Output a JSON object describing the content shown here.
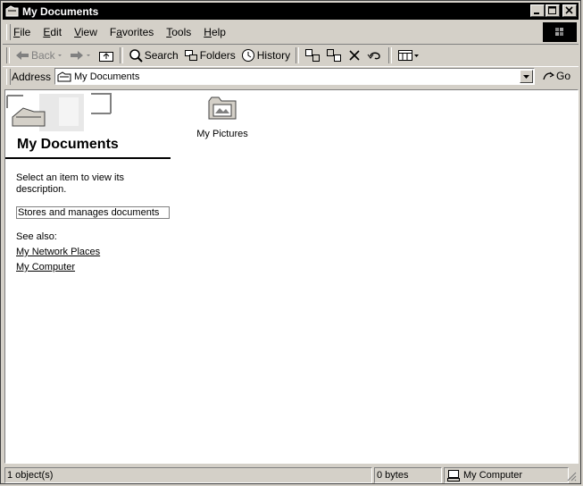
{
  "window": {
    "title": "My Documents"
  },
  "menu": [
    {
      "key": "F",
      "rest": "ile"
    },
    {
      "key": "E",
      "rest": "dit"
    },
    {
      "key": "V",
      "rest": "iew"
    },
    {
      "key": "F",
      "rest": "avorites",
      "prefix": "",
      "full": "Favorites"
    },
    {
      "key": "T",
      "rest": "ools"
    },
    {
      "key": "H",
      "rest": "elp"
    }
  ],
  "toolbar": {
    "back_label": "Back",
    "search_label": "Search",
    "folders_label": "Folders",
    "history_label": "History"
  },
  "address": {
    "label": "Address",
    "value": "My Documents",
    "go_label": "Go"
  },
  "left_pane": {
    "title": "My Documents",
    "description": "Select an item to view its description.",
    "info": "Stores and manages documents",
    "see_also": "See also:",
    "links": [
      "My Network Places",
      "My Computer"
    ]
  },
  "items": [
    {
      "label": "My Pictures",
      "icon": "my-pictures-folder-icon"
    }
  ],
  "status": {
    "objects": "1 object(s)",
    "size": "0 bytes",
    "zone": "My Computer"
  }
}
